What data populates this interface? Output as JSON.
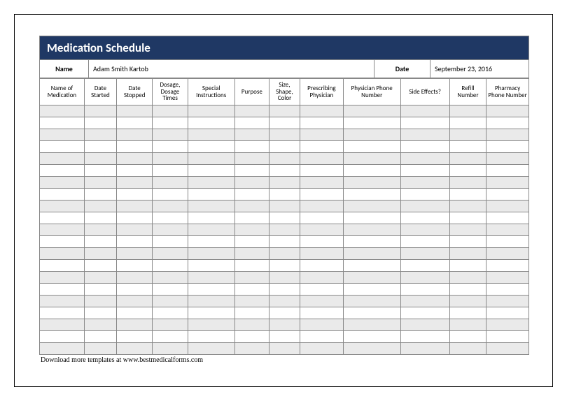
{
  "title": "Medication Schedule",
  "info": {
    "name_label": "Name",
    "name_value": "Adam Smith Kartob",
    "date_label": "Date",
    "date_value": "September 23, 2016"
  },
  "columns": [
    "Name of Medication",
    "Date Started",
    "Date Stopped",
    "Dosage, Dosage Times",
    "Special Instructions",
    "Purpose",
    "Size, Shape, Color",
    "Prescribing Physician",
    "Physician Phone Number",
    "Side Effects?",
    "Refill Number",
    "Pharmacy Phone Number"
  ],
  "row_count": 21,
  "footer": "Download more templates at www.bestmedicalforms.com"
}
